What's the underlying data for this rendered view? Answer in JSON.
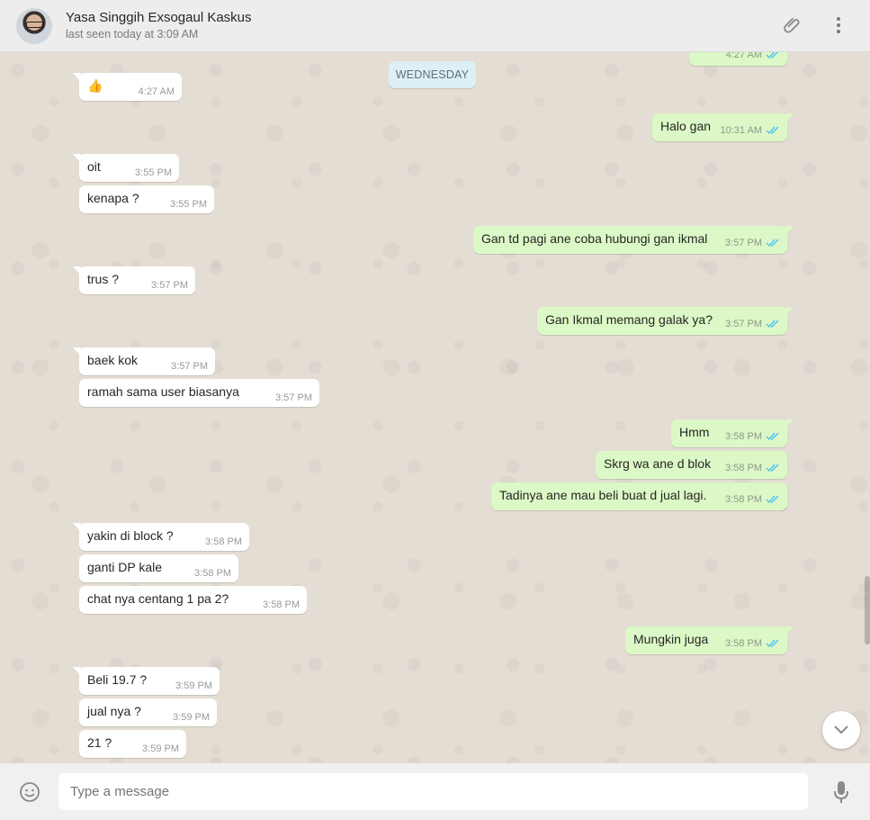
{
  "header": {
    "contact_name": "Yasa Singgih Exsogaul Kaskus",
    "status": "last seen today at 3:09 AM",
    "icons": [
      "attach-icon",
      "menu-icon"
    ]
  },
  "chat": {
    "date_label": "WEDNESDAY",
    "partial_top_time": "4:27 AM",
    "messages": [
      {
        "dir": "in",
        "text": "👍",
        "time": "4:27 AM"
      },
      {
        "dir": "out",
        "text": "Halo gan",
        "time": "10:31 AM"
      },
      {
        "dir": "in",
        "text": "oit",
        "time": "3:55 PM"
      },
      {
        "dir": "in",
        "text": "kenapa ?",
        "time": "3:55 PM"
      },
      {
        "dir": "out",
        "text": "Gan td pagi ane coba hubungi gan ikmal",
        "time": "3:57 PM"
      },
      {
        "dir": "in",
        "text": "trus ?",
        "time": "3:57 PM"
      },
      {
        "dir": "out",
        "text": "Gan Ikmal memang galak ya?",
        "time": "3:57 PM"
      },
      {
        "dir": "in",
        "text": "baek kok",
        "time": "3:57 PM"
      },
      {
        "dir": "in",
        "text": "ramah sama user  biasanya",
        "time": "3:57 PM"
      },
      {
        "dir": "out",
        "text": "Hmm",
        "time": "3:58 PM"
      },
      {
        "dir": "out",
        "text": "Skrg wa ane d blok",
        "time": "3:58 PM"
      },
      {
        "dir": "out",
        "text": "Tadinya ane mau beli buat d jual lagi.",
        "time": "3:58 PM"
      },
      {
        "dir": "in",
        "text": "yakin di block ?",
        "time": "3:58 PM"
      },
      {
        "dir": "in",
        "text": "ganti DP kale",
        "time": "3:58 PM"
      },
      {
        "dir": "in",
        "text": "chat nya centang 1 pa  2?",
        "time": "3:58 PM"
      },
      {
        "dir": "out",
        "text": "Mungkin juga",
        "time": "3:58 PM"
      },
      {
        "dir": "in",
        "text": "Beli 19.7 ?",
        "time": "3:59 PM"
      },
      {
        "dir": "in",
        "text": "jual nya ?",
        "time": "3:59 PM"
      },
      {
        "dir": "in",
        "text": "21 ?",
        "time": "3:59 PM"
      }
    ]
  },
  "footer": {
    "placeholder": "Type a message",
    "icons": [
      "emoji-icon",
      "microphone-icon"
    ]
  },
  "colors": {
    "incoming": "#ffffff",
    "outgoing": "#dcf8c6",
    "read_ticks": "#4fc3f7"
  }
}
